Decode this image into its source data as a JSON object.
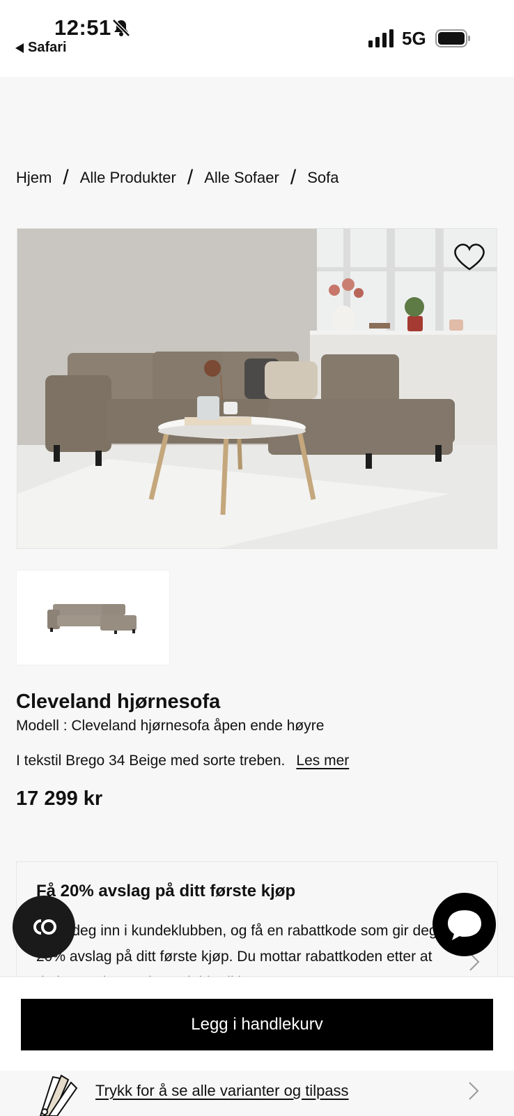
{
  "status_bar": {
    "time": "12:51",
    "back_app": "Safari",
    "network": "5G"
  },
  "breadcrumb": [
    "Hjem",
    "Alle Produkter",
    "Alle Sofaer",
    "Sofa"
  ],
  "breadcrumb_separator": "/",
  "product": {
    "title": "Cleveland hjørnesofa",
    "model": "Modell : Cleveland hjørnesofa åpen ende høyre",
    "description": "I tekstil Brego 34 Beige med sorte treben.",
    "read_more": "Les mer",
    "price": "17 299 kr"
  },
  "promo": {
    "title": "Få 20% avslag på ditt første kjøp",
    "body": "Meld deg inn i kundeklubben, og få en rabattkode som gir deg 20% avslag på ditt første kjøp. Du mottar rabattkoden etter at du har registrert deg. Gjelder ikke"
  },
  "cart_button": "Legg i handlekurv",
  "variants_link": "Trykk for å se alle varianter og tilpass",
  "icons": {
    "bell": "bell-slash-icon",
    "signal": "cellular-signal-icon",
    "battery": "battery-icon",
    "favorite": "heart-icon",
    "co": "co-logo-icon",
    "chat": "chat-bubble-icon",
    "swatch": "fabric-swatch-icon",
    "chevron": "chevron-right-icon"
  },
  "colors": {
    "accent": "#000000",
    "background": "#f7f7f7",
    "sofa": "#857a6c"
  }
}
